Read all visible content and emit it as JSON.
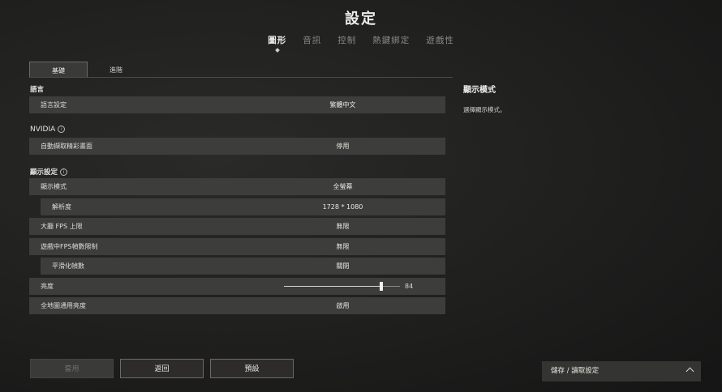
{
  "title": "設定",
  "top_tabs": [
    {
      "label": "圖形"
    },
    {
      "label": "音訊"
    },
    {
      "label": "控制"
    },
    {
      "label": "熱鍵綁定"
    },
    {
      "label": "遊戲性"
    }
  ],
  "sub_tabs": [
    {
      "label": "基礎"
    },
    {
      "label": "進階"
    }
  ],
  "sections": {
    "language": "語言",
    "nvidia": "NVIDIA",
    "display": "顯示設定"
  },
  "rows": {
    "language_setting": {
      "label": "語言設定",
      "value": "繁體中文"
    },
    "auto_highlights": {
      "label": "自動擷取精彩畫面",
      "value": "停用"
    },
    "display_mode": {
      "label": "顯示模式",
      "value": "全螢幕"
    },
    "resolution": {
      "label": "解析度",
      "value": "1728 * 1080"
    },
    "lobby_fps": {
      "label": "大廳 FPS 上限",
      "value": "無限"
    },
    "ingame_fps": {
      "label": "遊戲中FPS幀數限制",
      "value": "無限"
    },
    "smoothing": {
      "label": "平滑化幀數",
      "value": "關閉"
    },
    "brightness": {
      "label": "亮度",
      "value": "84",
      "slider_fraction": 0.84
    },
    "map_brightness": {
      "label": "全地圖通用亮度",
      "value": "啟用"
    }
  },
  "side_panel": {
    "title": "顯示模式",
    "description": "選擇顯示模式。"
  },
  "buttons": {
    "apply": "套用",
    "back": "返回",
    "default": "預設"
  },
  "save_panel": {
    "label": "儲存 / 讀取設定",
    "icon": "chevron-up-icon"
  }
}
